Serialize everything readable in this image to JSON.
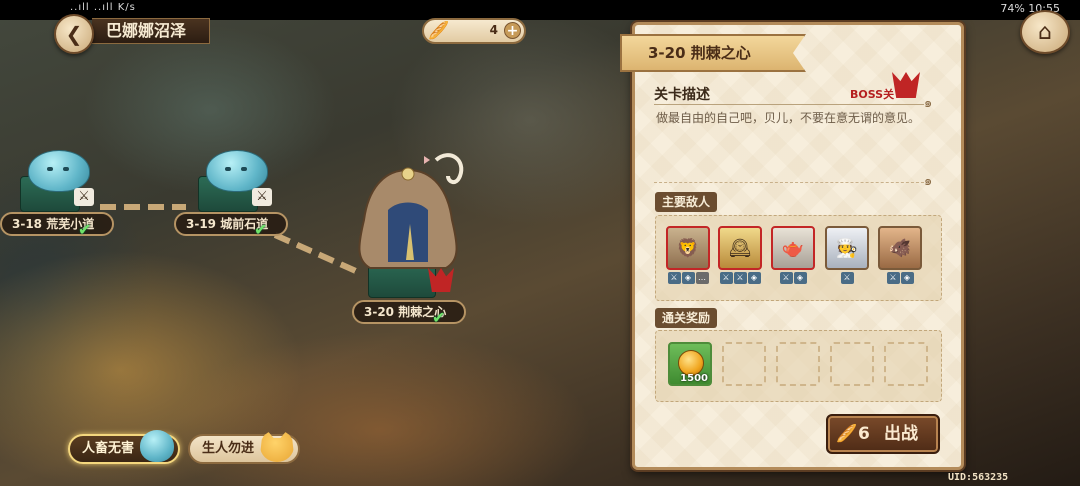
{
  "status_bar": {
    "left_text": "..ıll ..ıll  K/s",
    "right_text": "74%  10:55"
  },
  "header": {
    "back_icon": "back-arrow-icon",
    "region_name": "巴娜娜沼泽"
  },
  "resource": {
    "count": "4",
    "plus": "+"
  },
  "home_icon": "home-icon",
  "map": {
    "stages": [
      {
        "label": "3-18  荒芜小道",
        "cleared": true
      },
      {
        "label": "3-19  城前石道",
        "cleared": true
      },
      {
        "label": "3-20  荆棘之心",
        "cleared": true,
        "boss": true
      }
    ]
  },
  "filters": [
    {
      "label": "人畜无害",
      "active": true
    },
    {
      "label": "生人勿进",
      "active": false
    }
  ],
  "panel": {
    "stage_title": "3-20  荆棘之心",
    "desc_heading": "关卡描述",
    "boss_tag": "BOSS关",
    "description": "做最自由的自己吧，贝儿，不要在意无谓的意见。",
    "enemies_heading": "主要敌人",
    "rewards_heading": "通关奖励",
    "reward_amount": "1500",
    "go_cost": "6",
    "go_label": "出战"
  },
  "uid": "UID:563235",
  "colors": {
    "accent": "#b38b5a",
    "boss_red": "#c02525",
    "clear_green": "#6fe36a"
  }
}
